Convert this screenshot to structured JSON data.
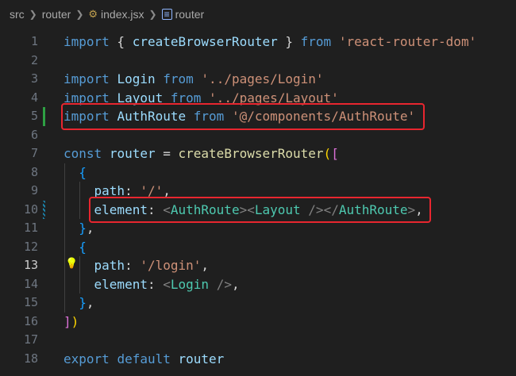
{
  "breadcrumb": {
    "seg1": "src",
    "seg2": "router",
    "seg3": "index.jsx",
    "seg4": "router"
  },
  "lines": [
    {
      "n": "1",
      "tokens": [
        [
          "k",
          "import"
        ],
        [
          "p",
          " { "
        ],
        [
          "v",
          "createBrowserRouter"
        ],
        [
          "p",
          " } "
        ],
        [
          "k",
          "from"
        ],
        [
          "p",
          " "
        ],
        [
          "s",
          "'react-router-dom'"
        ]
      ]
    },
    {
      "n": "2",
      "tokens": []
    },
    {
      "n": "3",
      "tokens": [
        [
          "k",
          "import"
        ],
        [
          "p",
          " "
        ],
        [
          "v",
          "Login"
        ],
        [
          "p",
          " "
        ],
        [
          "k",
          "from"
        ],
        [
          "p",
          " "
        ],
        [
          "s",
          "'../pages/Login'"
        ]
      ]
    },
    {
      "n": "4",
      "tokens": [
        [
          "k",
          "import"
        ],
        [
          "p",
          " "
        ],
        [
          "v",
          "Layout"
        ],
        [
          "p",
          " "
        ],
        [
          "k",
          "from"
        ],
        [
          "p",
          " "
        ],
        [
          "s",
          "'../pages/Layout'"
        ]
      ]
    },
    {
      "n": "5",
      "tokens": [
        [
          "k",
          "import"
        ],
        [
          "p",
          " "
        ],
        [
          "v",
          "AuthRoute"
        ],
        [
          "p",
          " "
        ],
        [
          "k",
          "from"
        ],
        [
          "p",
          " "
        ],
        [
          "s",
          "'@/components/AuthRoute'"
        ]
      ]
    },
    {
      "n": "6",
      "tokens": []
    },
    {
      "n": "7",
      "tokens": [
        [
          "k",
          "const"
        ],
        [
          "p",
          " "
        ],
        [
          "v",
          "router"
        ],
        [
          "p",
          " = "
        ],
        [
          "f",
          "createBrowserRouter"
        ],
        [
          "br1",
          "("
        ],
        [
          "br2",
          "["
        ]
      ]
    },
    {
      "n": "8",
      "tokens": [
        [
          "p",
          "  "
        ],
        [
          "br3",
          "{"
        ]
      ]
    },
    {
      "n": "9",
      "tokens": [
        [
          "p",
          "    "
        ],
        [
          "v",
          "path"
        ],
        [
          "p",
          ": "
        ],
        [
          "s",
          "'/'"
        ],
        [
          "p",
          ","
        ]
      ]
    },
    {
      "n": "10",
      "tokens": [
        [
          "p",
          "    "
        ],
        [
          "v",
          "element"
        ],
        [
          "p",
          ": "
        ],
        [
          "tg",
          "<"
        ],
        [
          "t",
          "AuthRoute"
        ],
        [
          "tg",
          ">"
        ],
        [
          "tg",
          "<"
        ],
        [
          "t",
          "Layout"
        ],
        [
          "p",
          " "
        ],
        [
          "tg",
          "/>"
        ],
        [
          "tg",
          "</"
        ],
        [
          "t",
          "AuthRoute"
        ],
        [
          "tg",
          ">"
        ],
        [
          "p",
          ","
        ]
      ]
    },
    {
      "n": "11",
      "tokens": [
        [
          "p",
          "  "
        ],
        [
          "br3",
          "}"
        ],
        [
          "p",
          ","
        ]
      ]
    },
    {
      "n": "12",
      "tokens": [
        [
          "p",
          "  "
        ],
        [
          "br3",
          "{"
        ]
      ]
    },
    {
      "n": "13",
      "tokens": [
        [
          "p",
          "    "
        ],
        [
          "v",
          "path"
        ],
        [
          "p",
          ": "
        ],
        [
          "s",
          "'/login'"
        ],
        [
          "p",
          ","
        ]
      ]
    },
    {
      "n": "14",
      "tokens": [
        [
          "p",
          "    "
        ],
        [
          "v",
          "element"
        ],
        [
          "p",
          ": "
        ],
        [
          "tg",
          "<"
        ],
        [
          "t",
          "Login"
        ],
        [
          "p",
          " "
        ],
        [
          "tg",
          "/>"
        ],
        [
          "p",
          ","
        ]
      ]
    },
    {
      "n": "15",
      "tokens": [
        [
          "p",
          "  "
        ],
        [
          "br3",
          "}"
        ],
        [
          "p",
          ","
        ]
      ]
    },
    {
      "n": "16",
      "tokens": [
        [
          "br2",
          "]"
        ],
        [
          "br1",
          ")"
        ]
      ]
    },
    {
      "n": "17",
      "tokens": []
    },
    {
      "n": "18",
      "tokens": [
        [
          "k",
          "export"
        ],
        [
          "p",
          " "
        ],
        [
          "k",
          "default"
        ],
        [
          "p",
          " "
        ],
        [
          "v",
          "router"
        ]
      ]
    }
  ],
  "active_line": "13",
  "colors": {
    "highlight_box": "#e8262f",
    "git_added": "#2ea043",
    "lightbulb": "#ffcc00"
  }
}
